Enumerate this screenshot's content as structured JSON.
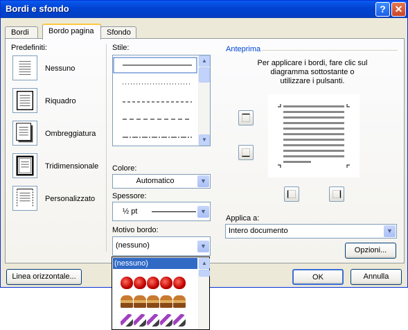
{
  "window": {
    "title": "Bordi e sfondo"
  },
  "tabs": [
    {
      "label": "Bordi"
    },
    {
      "label": "Bordo pagina"
    },
    {
      "label": "Sfondo"
    }
  ],
  "presets": {
    "heading": "Predefiniti:",
    "items": [
      {
        "label": "Nessuno"
      },
      {
        "label": "Riquadro"
      },
      {
        "label": "Ombreggiatura"
      },
      {
        "label": "Tridimensionale"
      },
      {
        "label": "Personalizzato"
      }
    ]
  },
  "style": {
    "label": "Stile:"
  },
  "color": {
    "label": "Colore:",
    "value": "Automatico"
  },
  "width": {
    "label": "Spessore:",
    "value": "½ pt"
  },
  "art": {
    "label": "Motivo bordo:",
    "value": "(nessuno)",
    "options": [
      "(nessuno)"
    ]
  },
  "preview": {
    "heading": "Anteprima",
    "instructions_1": "Per applicare i bordi, fare clic sul",
    "instructions_2": "diagramma sottostante o",
    "instructions_3": "utilizzare i pulsanti."
  },
  "apply_to": {
    "label": "Applica a:",
    "value": "Intero documento"
  },
  "buttons": {
    "options": "Opzioni...",
    "horizontal_line": "Linea orizzontale...",
    "ok": "OK",
    "cancel": "Annulla"
  },
  "colors": {
    "title_bar": "#0243d3",
    "selection": "#316ac5",
    "dialog_bg": "#ece9d8"
  }
}
